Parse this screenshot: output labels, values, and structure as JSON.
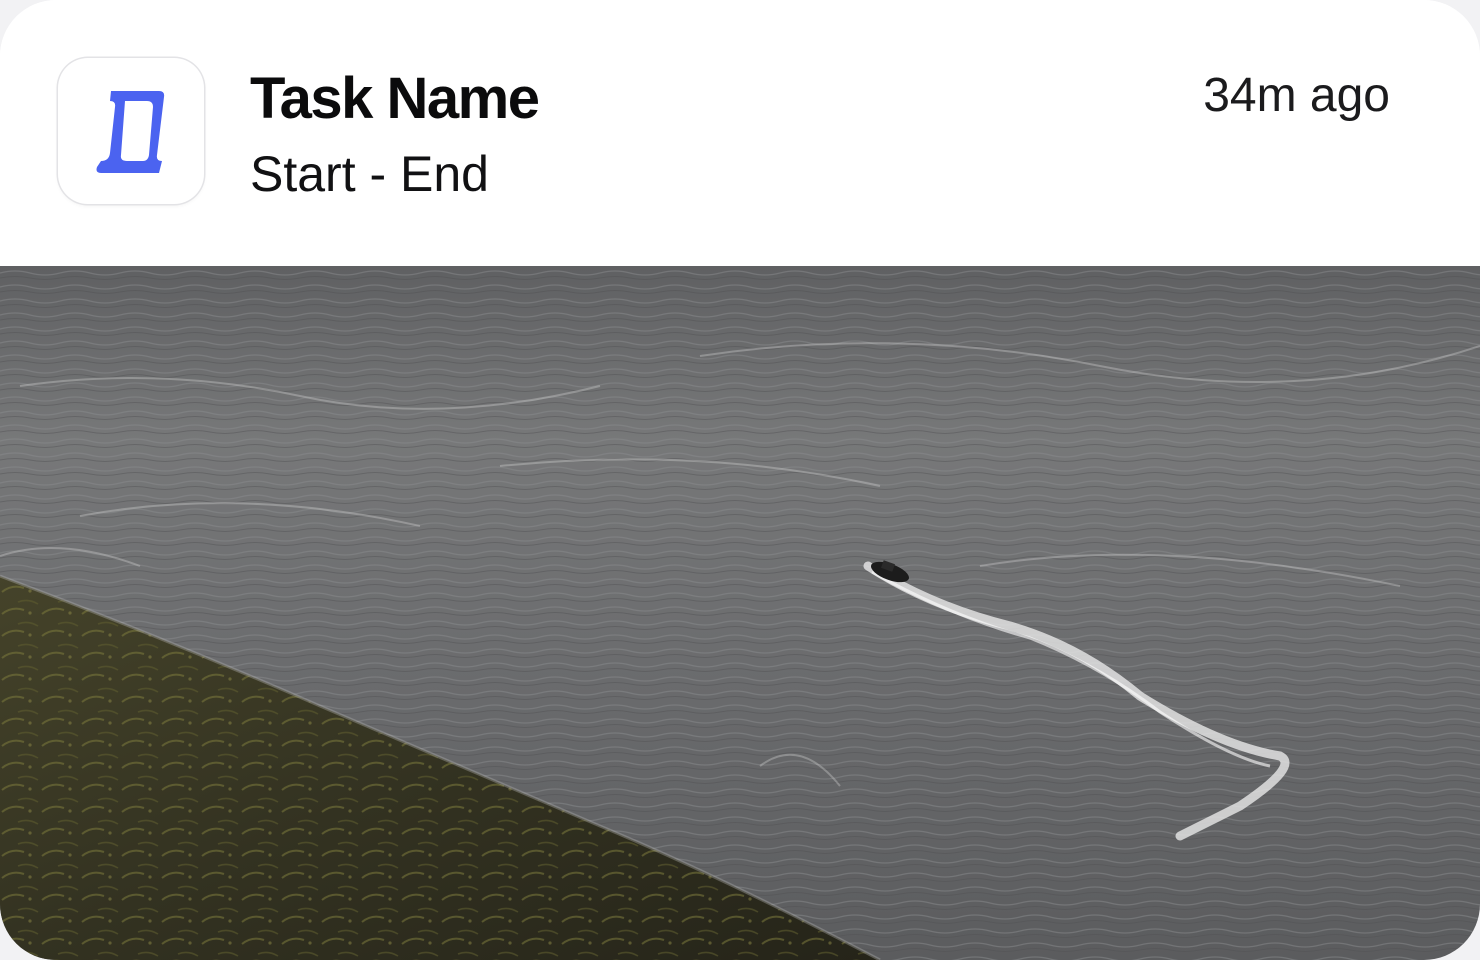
{
  "notification": {
    "app_icon": "task-app-icon",
    "title": "Task Name",
    "subtitle": "Start - End",
    "timestamp": "34m ago"
  },
  "media": {
    "kind": "photo",
    "depiction": "aerial-sea-with-boat-and-grassy-hillside"
  },
  "colors": {
    "accent": "#4b63f0",
    "sea": "#6f7072",
    "hillside": "#3a3922"
  }
}
